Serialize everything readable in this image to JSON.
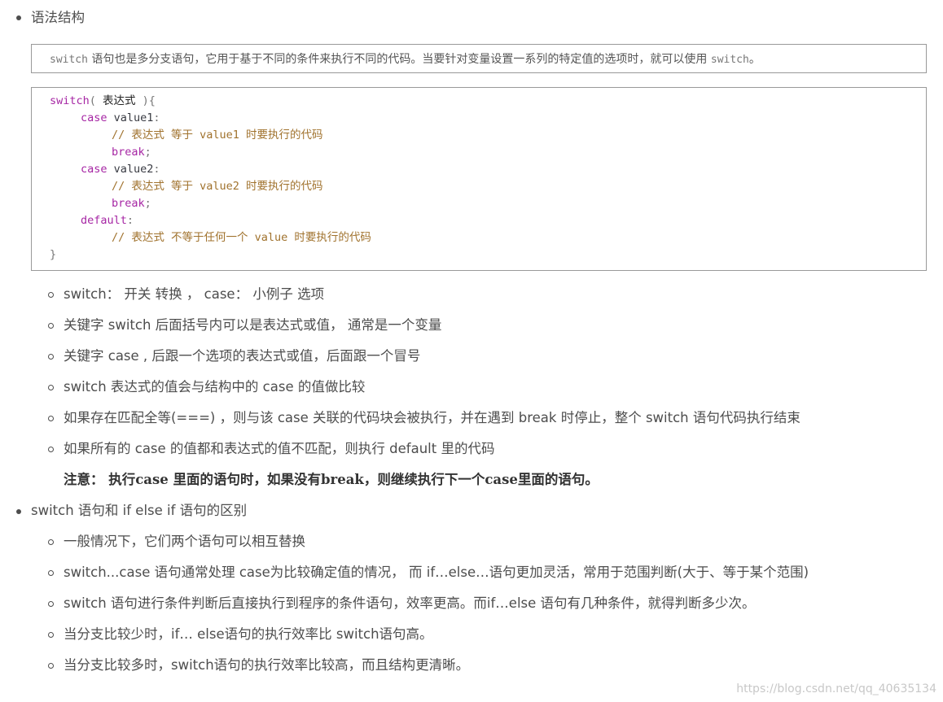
{
  "heading1": "语法结构",
  "intro_box": {
    "code1": "switch",
    "text": " 语句也是多分支语句，它用于基于不同的条件来执行不同的代码。当要针对变量设置一系列的特定值的选项时，就可以使用 ",
    "code2": "switch",
    "end": "。"
  },
  "code_block": {
    "l1_kw": "switch",
    "l1_open": "( ",
    "l1_expr": "表达式",
    "l1_close": " ){",
    "l2_kw": "case",
    "l2_val": " value1",
    "l2_colon": ":",
    "l3_comment": "// 表达式 等于 value1 时要执行的代码",
    "l4_kw": "break",
    "l4_semi": ";",
    "l5_kw": "case",
    "l5_val": " value2",
    "l5_colon": ":",
    "l6_comment": "// 表达式 等于 value2 时要执行的代码",
    "l7_kw": "break",
    "l7_semi": ";",
    "l8_kw": "default",
    "l8_colon": ":",
    "l9_comment": "// 表达式 不等于任何一个 value 时要执行的代码",
    "l10": "}"
  },
  "sub_items_1": [
    "switch： 开关 转换 ， case： 小例子  选项",
    "关键字 switch 后面括号内可以是表达式或值， 通常是一个变量",
    "关键字 case , 后跟一个选项的表达式或值，后面跟一个冒号",
    "switch 表达式的值会与结构中的 case 的值做比较",
    "如果存在匹配全等(===) ，则与该 case 关联的代码块会被执行，并在遇到 break 时停止，整个 switch 语句代码执行结束",
    "如果所有的 case 的值都和表达式的值不匹配，则执行 default 里的代码"
  ],
  "note": "注意： 执行case 里面的语句时，如果没有break，则继续执行下一个case里面的语句。",
  "heading2": "switch 语句和 if else if 语句的区别",
  "sub_items_2": [
    "一般情况下，它们两个语句可以相互替换",
    "switch...case 语句通常处理 case为比较确定值的情况， 而 if…else…语句更加灵活，常用于范围判断(大于、等于某个范围)",
    "switch 语句进行条件判断后直接执行到程序的条件语句，效率更高。而if…else 语句有几种条件，就得判断多少次。",
    "当分支比较少时，if… else语句的执行效率比 switch语句高。",
    "当分支比较多时，switch语句的执行效率比较高，而且结构更清晰。"
  ],
  "watermark": "https://blog.csdn.net/qq_40635134"
}
